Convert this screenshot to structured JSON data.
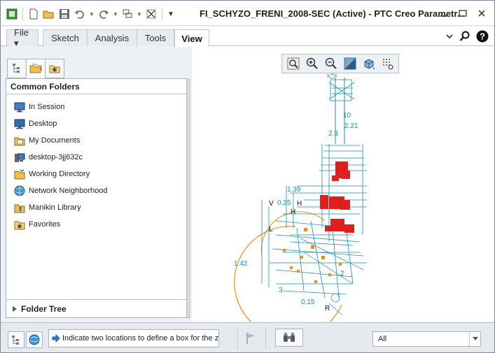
{
  "window": {
    "title": "FI_SCHYZO_FRENI_2008-SEC (Active) - PTC Creo Parametr..."
  },
  "quick_access": {
    "icons": [
      "app-icon",
      "new-icon",
      "open-icon",
      "save-icon",
      "undo-icon",
      "redo-icon",
      "regenerate-icon",
      "close-window-icon"
    ]
  },
  "ribbon": {
    "tabs": [
      {
        "label": "File ▾",
        "active": false
      },
      {
        "label": "Sketch",
        "active": false
      },
      {
        "label": "Analysis",
        "active": false
      },
      {
        "label": "Tools",
        "active": false
      },
      {
        "label": "View",
        "active": true
      }
    ]
  },
  "browser": {
    "header": "Common Folders",
    "items": [
      {
        "label": "In Session",
        "icon": "monitor-icon"
      },
      {
        "label": "Desktop",
        "icon": "desktop-icon"
      },
      {
        "label": "My Documents",
        "icon": "documents-icon"
      },
      {
        "label": "desktop-3jj632c",
        "icon": "computer-icon"
      },
      {
        "label": "Working Directory",
        "icon": "working-directory-icon"
      },
      {
        "label": "Network Neighborhood",
        "icon": "network-icon"
      },
      {
        "label": "Manikin Library",
        "icon": "manikin-library-icon"
      },
      {
        "label": "Favorites",
        "icon": "favorites-icon"
      }
    ],
    "folder_tree_label": "Folder Tree"
  },
  "graphics": {
    "toolbar_icons": [
      "zoom-to-fit-icon",
      "zoom-in-icon",
      "zoom-out-icon",
      "repaint-icon",
      "display-style-icon",
      "sketcher-display-filter-icon"
    ],
    "dimension_labels": [
      "1.39",
      "0.25",
      "1.42",
      "2.21",
      "2.3",
      "0.15",
      "10",
      "2",
      "3"
    ]
  },
  "status": {
    "message": "Indicate two locations to define a box for the z",
    "filter_value": "All"
  },
  "colors": {
    "accent_blue": "#1f5fa8",
    "dimension_blue": "#1a8fb0",
    "constraint_red": "#e02020",
    "arc_orange": "#e8900f"
  }
}
